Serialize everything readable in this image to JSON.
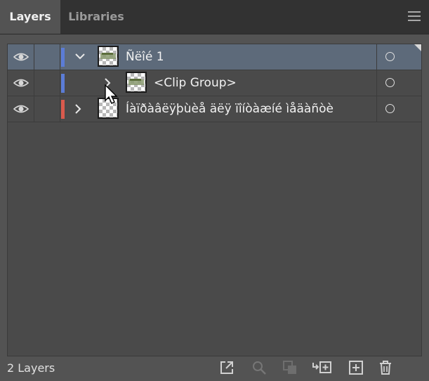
{
  "tabs": [
    {
      "label": "Layers",
      "active": true
    },
    {
      "label": "Libraries",
      "active": false
    }
  ],
  "rows": [
    {
      "name": "Ñëîé 1",
      "expanded": true,
      "color": "#5b7cd6",
      "selected": true
    },
    {
      "name": "<Clip Group>",
      "expanded": false,
      "color": "#5b7cd6",
      "selected": false
    },
    {
      "name": "Íàïðàâëÿþùèå äëÿ ïîíòàæíé ìåäàñòè",
      "expanded": false,
      "color": "#d95a4d",
      "selected": false
    }
  ],
  "footer": {
    "count_label": "2 Layers",
    "icons": [
      "export-icon",
      "search-icon",
      "make-clipping-mask-icon",
      "create-sublayer-icon",
      "new-layer-icon",
      "trash-icon"
    ]
  },
  "colors": {
    "panel": "#535353",
    "tabbar": "#323232",
    "selected_row": "#5d6a7a"
  }
}
